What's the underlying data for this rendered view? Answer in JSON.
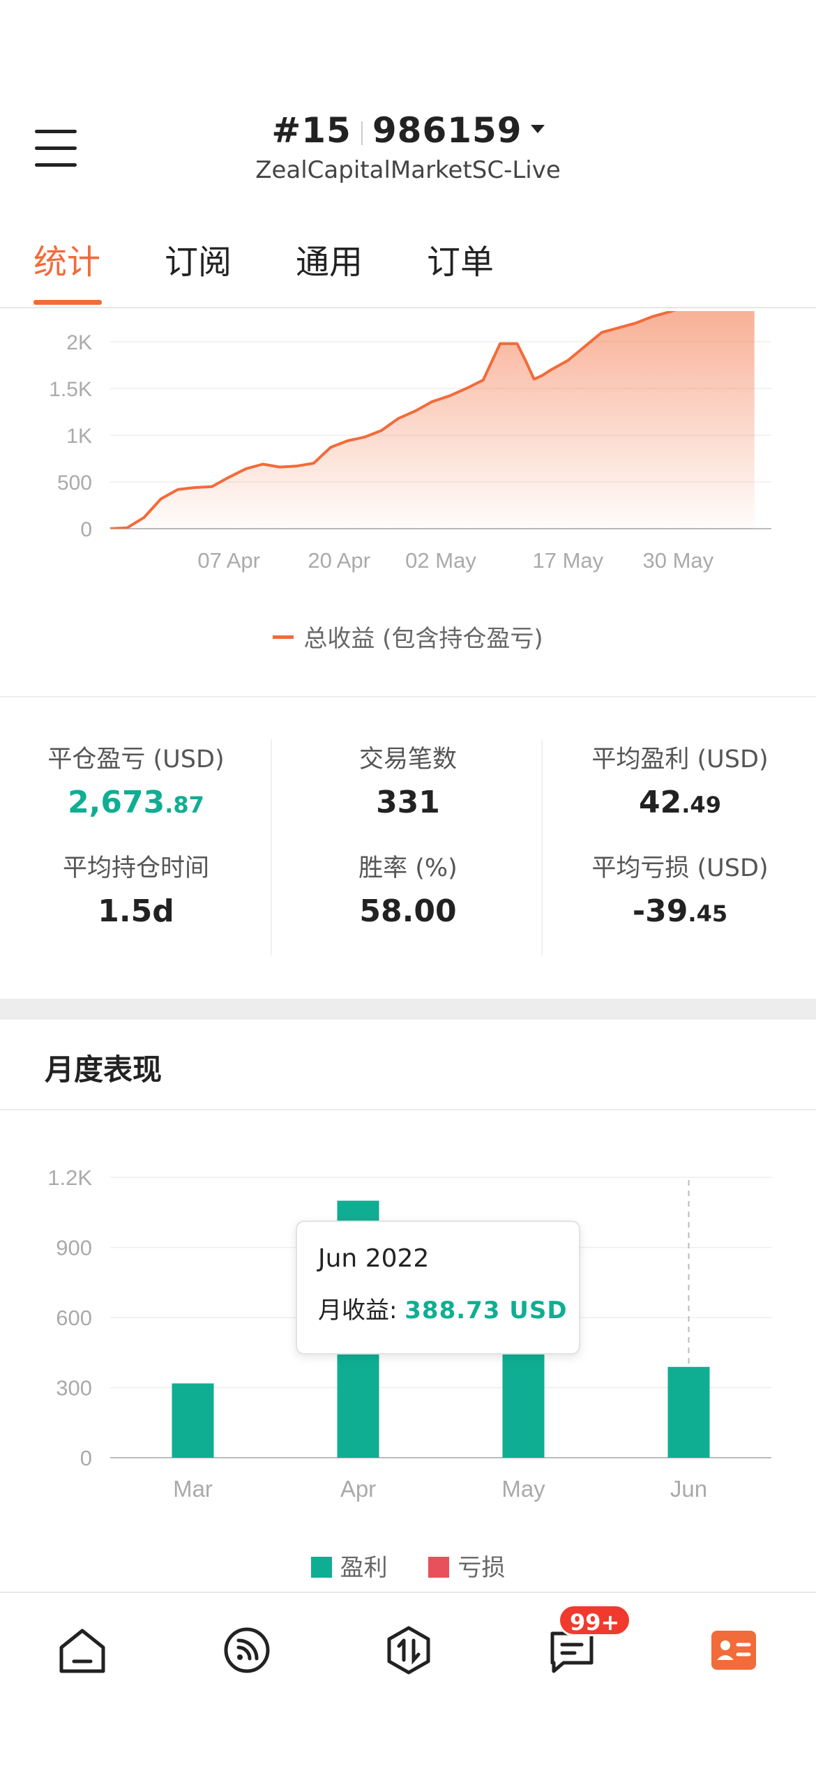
{
  "header": {
    "account_number": "#15",
    "account_login": "986159",
    "server": "ZealCapitalMarketSC-Live"
  },
  "tabs": [
    {
      "label": "统计",
      "active": true
    },
    {
      "label": "订阅",
      "active": false
    },
    {
      "label": "通用",
      "active": false
    },
    {
      "label": "订单",
      "active": false
    }
  ],
  "colors": {
    "accent": "#f26b3a",
    "profit": "#0fae92",
    "loss": "#e8505b"
  },
  "chart_data": [
    {
      "type": "area",
      "y_tick_labels": [
        "0",
        "500",
        "1K",
        "1.5K",
        "2K"
      ],
      "x_tick_labels": [
        "07 Apr",
        "20 Apr",
        "02 May",
        "17 May",
        "30 May"
      ],
      "ylim": [
        0,
        2000
      ],
      "series": [
        {
          "name": "总收益 (包含持仓盈亏)",
          "color": "#f26b3a",
          "x": [
            "2022-03-24",
            "2022-03-26",
            "2022-03-28",
            "2022-03-30",
            "2022-04-01",
            "2022-04-03",
            "2022-04-05",
            "2022-04-07",
            "2022-04-09",
            "2022-04-11",
            "2022-04-13",
            "2022-04-15",
            "2022-04-17",
            "2022-04-19",
            "2022-04-21",
            "2022-04-23",
            "2022-04-25",
            "2022-04-27",
            "2022-04-29",
            "2022-05-01",
            "2022-05-03",
            "2022-05-05",
            "2022-05-07",
            "2022-05-09",
            "2022-05-11",
            "2022-05-12",
            "2022-05-13",
            "2022-05-14",
            "2022-05-15",
            "2022-05-17",
            "2022-05-19",
            "2022-05-21",
            "2022-05-23",
            "2022-05-25",
            "2022-05-27",
            "2022-05-29",
            "2022-05-31",
            "2022-06-02",
            "2022-06-04",
            "2022-06-06",
            "2022-06-08"
          ],
          "values": [
            0,
            10,
            120,
            320,
            420,
            440,
            450,
            550,
            640,
            690,
            660,
            670,
            700,
            870,
            940,
            980,
            1050,
            1180,
            1260,
            1360,
            1420,
            1500,
            1590,
            1980,
            1980,
            1800,
            1600,
            1640,
            1700,
            1800,
            1950,
            2100,
            2150,
            2200,
            2270,
            2320,
            2380,
            2420,
            2420,
            2420,
            2420
          ]
        }
      ],
      "legend": "bottom-center",
      "grid": true
    },
    {
      "type": "bar",
      "categories": [
        "Mar",
        "Apr",
        "May",
        "Jun"
      ],
      "y_tick_labels": [
        "0",
        "300",
        "600",
        "900",
        "1.2K"
      ],
      "ylim": [
        0,
        1200
      ],
      "series": [
        {
          "name": "盈利",
          "color": "#0fae92",
          "values": [
            318,
            1100,
            820,
            388.73
          ]
        },
        {
          "name": "亏损",
          "color": "#e8505b",
          "values": [
            0,
            0,
            0,
            0
          ]
        }
      ],
      "legend": "bottom-center",
      "grid": true,
      "highlighted": "Jun"
    }
  ],
  "legend1_label": "总收益 (包含持仓盈亏)",
  "stats": {
    "closed_pnl": {
      "label": "平仓盈亏 (USD)",
      "int": "2,673",
      "dec": ".87"
    },
    "trades": {
      "label": "交易笔数",
      "value": "331"
    },
    "avg_profit": {
      "label": "平均盈利 (USD)",
      "int": "42",
      "dec": ".49"
    },
    "avg_hold": {
      "label": "平均持仓时间",
      "value": "1.5d"
    },
    "win_rate": {
      "label": "胜率 (%)",
      "value": "58.00"
    },
    "avg_loss": {
      "label": "平均亏损 (USD)",
      "int": "-39",
      "dec": ".45"
    }
  },
  "monthly": {
    "title": "月度表现",
    "tooltip_date": "Jun 2022",
    "tooltip_label": "月收益: ",
    "tooltip_value": "388.73 USD",
    "legend_profit": "盈利",
    "legend_loss": "亏损"
  },
  "bottom_nav": {
    "items": [
      "home-icon",
      "feed-icon",
      "trade-icon",
      "messages-icon",
      "profile-card-icon"
    ],
    "badge": "99+"
  }
}
